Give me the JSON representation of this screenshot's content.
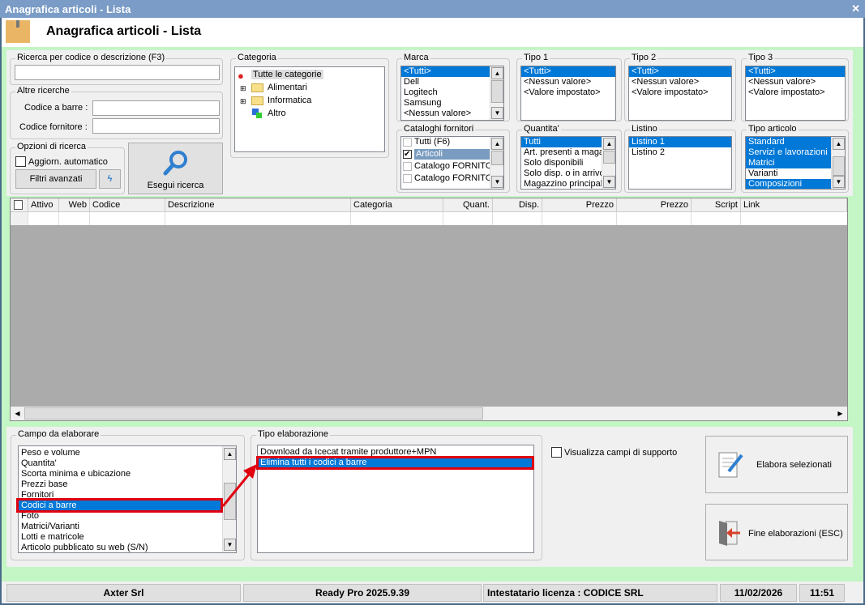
{
  "window": {
    "title": "Anagrafica articoli  - Lista",
    "close": "✕"
  },
  "header": {
    "title": "Anagrafica articoli  - Lista"
  },
  "search": {
    "group": "Ricerca per codice o descrizione (F3)",
    "value": ""
  },
  "altre": {
    "group": "Altre ricerche",
    "barcode_label": "Codice a barre :",
    "supplier_label": "Codice fornitore :"
  },
  "opzioni": {
    "group": "Opzioni di ricerca",
    "auto_label": "Aggiorn. automatico",
    "auto_checked": false,
    "filters": "Filtri avanzati"
  },
  "esegui": {
    "label": "Esegui ricerca"
  },
  "categoria": {
    "group": "Categoria",
    "root": "Tutte le categorie",
    "items": [
      "Alimentari",
      "Informatica",
      "Altro"
    ]
  },
  "marca": {
    "group": "Marca",
    "items": [
      "<Tutti>",
      "Dell",
      "Logitech",
      "Samsung",
      "<Nessun valore>"
    ],
    "selected": 0
  },
  "tipo1": {
    "group": "Tipo 1",
    "items": [
      "<Tutti>",
      "<Nessun valore>",
      "<Valore impostato>"
    ]
  },
  "tipo2": {
    "group": "Tipo 2",
    "items": [
      "<Tutti>",
      "<Nessun valore>",
      "<Valore impostato>"
    ]
  },
  "tipo3": {
    "group": "Tipo 3",
    "items": [
      "<Tutti>",
      "<Nessun valore>",
      "<Valore impostato>"
    ]
  },
  "cataloghi": {
    "group": "Cataloghi fornitori",
    "items": [
      {
        "label": "Tutti (F6)",
        "checked": false
      },
      {
        "label": "Articoli",
        "checked": true
      },
      {
        "label": "Catalogo FORNITOF",
        "checked": false
      },
      {
        "label": "Catalogo FORNITOF",
        "checked": false
      }
    ]
  },
  "quantita": {
    "group": "Quantita'",
    "items": [
      "Tutti",
      "Art. presenti a magazzino",
      "Solo disponibili",
      "Solo disp. o in arrivo",
      "Magazzino principale"
    ]
  },
  "listino": {
    "group": "Listino",
    "items": [
      "Listino 1",
      "Listino 2"
    ]
  },
  "tipo_articolo": {
    "group": "Tipo articolo",
    "items": [
      "Standard",
      "Servizi e lavorazioni",
      "Matrici",
      "Varianti",
      "Composizioni"
    ],
    "selected": [
      0,
      1,
      2,
      4
    ]
  },
  "grid": {
    "columns": [
      "",
      "Attivo",
      "Web",
      "Codice",
      "Descrizione",
      "Categoria",
      "Quant.",
      "Disp.",
      "Prezzo",
      "Prezzo",
      "Script",
      "Link"
    ]
  },
  "campo": {
    "group": "Campo da elaborare",
    "items": [
      "Peso e volume",
      "Quantita'",
      "Scorta minima e ubicazione",
      "Prezzi base",
      "Fornitori",
      "Codici a barre",
      "Foto",
      "Matrici/Varianti",
      "Lotti e matricole",
      "Articolo pubblicato su web (S/N)"
    ],
    "selected": 5
  },
  "tipo_elab": {
    "group": "Tipo elaborazione",
    "items": [
      "Download da Icecat tramite produttore+MPN",
      "Elimina tutti i codici a barre"
    ],
    "selected": 1
  },
  "support": {
    "label": "Visualizza campi di supporto",
    "checked": false
  },
  "buttons": {
    "elabora": "Elabora selezionati",
    "fine": "Fine elaborazioni (ESC)"
  },
  "statusbar": {
    "company": "Axter Srl",
    "version": "Ready Pro 2025.9.39",
    "license": "Intestatario licenza : CODICE SRL",
    "date": "11/02/2026",
    "time": "11:51"
  },
  "colors": {
    "accent": "#0078d7",
    "highlight": "#e0000f",
    "background": "#c4f5c4"
  }
}
